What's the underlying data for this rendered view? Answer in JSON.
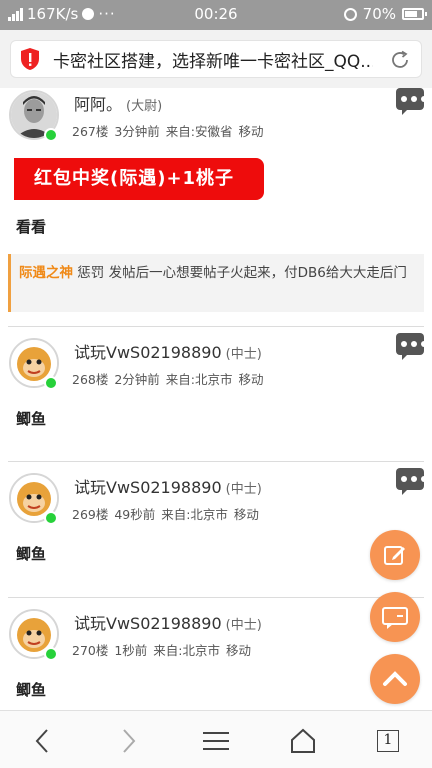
{
  "statusbar": {
    "speed": "167K/s",
    "time": "00:26",
    "battery": "70%"
  },
  "titlebar": {
    "title": "卡密社区搭建，选择新唯一卡密社区_QQ..."
  },
  "posts": [
    {
      "name": "阿阿。",
      "rank": "(大尉)",
      "meta": "267楼  3分钟前 来自:安徽省 移动",
      "text": "看看",
      "banner": "红包中奖(际遇)+1桃子"
    },
    {
      "name": "试玩VwS02198890",
      "rank": "(中士)",
      "meta": "268楼  2分钟前 来自:北京市 移动",
      "text": "鲫鱼"
    },
    {
      "name": "试玩VwS02198890",
      "rank": "(中士)",
      "meta": "269楼  49秒前 来自:北京市 移动",
      "text": "鲫鱼"
    },
    {
      "name": "试玩VwS02198890",
      "rank": "(中士)",
      "meta": "270楼  1秒前 来自:北京市 移动",
      "text": "鲫鱼"
    }
  ],
  "quote": {
    "who": "际遇之神",
    "text": "惩罚 发帖后一心想要帖子火起来，付DB6给大大走后门"
  },
  "bottomnav": {
    "tabs": "1"
  },
  "colors": {
    "accent": "#f79453",
    "banner": "#ee0c0c",
    "online": "#27d13a",
    "quote_name": "#f08a18"
  }
}
